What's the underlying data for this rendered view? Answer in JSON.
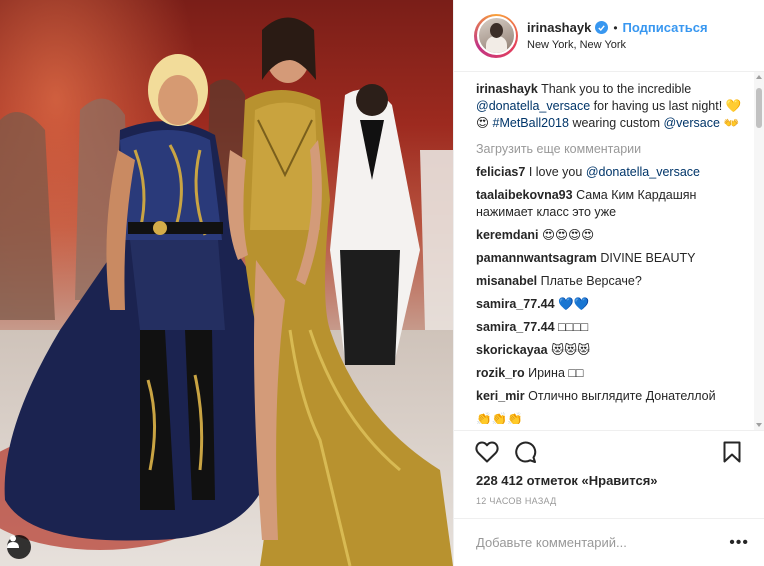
{
  "post": {
    "username": "irinashayk",
    "follow_label": "Подписаться",
    "separator": "•",
    "location": "New York, New York",
    "caption": {
      "username": "irinashayk",
      "text_1": "Thank you to the incredible",
      "mention_1": "@donatella_versace",
      "text_2": "for having us last night!",
      "emoji_1": "💛😍",
      "hashtag": "#MetBall2018",
      "text_3": "wearing custom",
      "mention_2": "@versace",
      "emoji_2": "👐"
    },
    "load_more": "Загрузить еще комментарии",
    "comments": [
      {
        "user": "felicias7",
        "text": "I love you",
        "mention": "@donatella_versace"
      },
      {
        "user": "taalaibekovna93",
        "text": "Сама Ким Кардашян нажимает класс это уже"
      },
      {
        "user": "keremdani",
        "text": "😍😍😍😍"
      },
      {
        "user": "pamannwantsagram",
        "text": "DIVINE BEAUTY"
      },
      {
        "user": "misanabel",
        "text": "Платье Версаче?"
      },
      {
        "user": "samira_77.44",
        "text": "💙💙"
      },
      {
        "user": "samira_77.44",
        "text": "□□□□"
      },
      {
        "user": "skorickayaa",
        "text": "😻😻😻"
      },
      {
        "user": "rozik_ro",
        "text": "Ирина □□"
      },
      {
        "user": "keri_mir",
        "text": "Отлично выглядите Донателлой"
      },
      {
        "user": "",
        "text": "👏👏👏"
      }
    ],
    "likes": "228 412 отметок «Нравится»",
    "time": "12 часов назад",
    "comment_placeholder": "Добавьте комментарий...",
    "more_label": "•••"
  },
  "icons": {
    "like": "heart-icon",
    "comment": "comment-bubble-icon",
    "save": "bookmark-icon",
    "tagged": "user-tag-icon",
    "verified": "verified-badge-icon"
  },
  "colors": {
    "accent": "#3897f0",
    "mention": "#003569",
    "muted": "#999999",
    "text": "#262626"
  }
}
